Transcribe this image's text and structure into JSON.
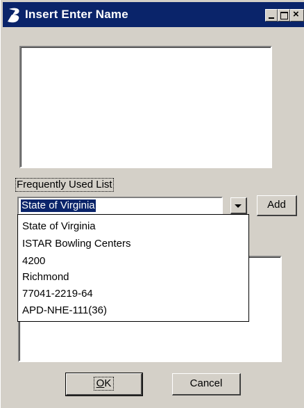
{
  "window": {
    "title": "Insert Enter Name"
  },
  "frequently_used": {
    "label": "Frequently Used List",
    "selected_value": "State of Virginia",
    "options": [
      "State of Virginia",
      "ISTAR Bowling Centers",
      "4200",
      "Richmond",
      "77041-2219-64",
      "APD-NHE-111(36)"
    ]
  },
  "buttons": {
    "add": "Add",
    "ok_mnemonic": "O",
    "ok_rest": "K",
    "cancel": "Cancel"
  },
  "icons": {
    "app": "bentley-b-icon",
    "minimize": "minimize-icon",
    "maximize": "maximize-icon",
    "close": "close-icon",
    "dropdown": "chevron-down-icon"
  }
}
